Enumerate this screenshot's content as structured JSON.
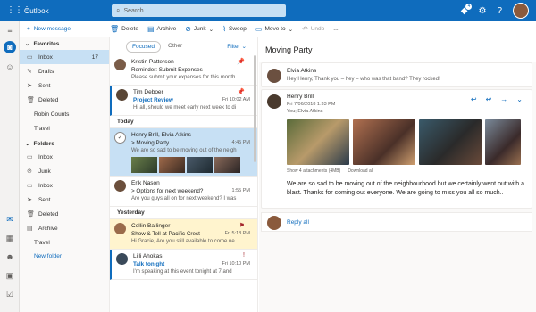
{
  "app": {
    "title": "Outlook"
  },
  "search": {
    "placeholder": "Search"
  },
  "topbar": {
    "notify_count": "4"
  },
  "command_bar": {
    "new_message": "New message",
    "delete": "Delete",
    "archive": "Archive",
    "junk": "Junk",
    "sweep": "Sweep",
    "move_to": "Move to",
    "undo": "Undo",
    "more": "..."
  },
  "sidebar": {
    "favorites_label": "Favorites",
    "favorites": [
      {
        "label": "Inbox",
        "count": "17"
      },
      {
        "label": "Drafts"
      },
      {
        "label": "Sent"
      },
      {
        "label": "Deleted"
      },
      {
        "label": "Robin Counts"
      },
      {
        "label": "Travel"
      }
    ],
    "folders_label": "Folders",
    "folders": [
      {
        "label": "Inbox"
      },
      {
        "label": "Junk"
      },
      {
        "label": "Inbox"
      },
      {
        "label": "Sent"
      },
      {
        "label": "Deleted"
      },
      {
        "label": "Archive"
      },
      {
        "label": "Travel"
      }
    ],
    "new_folder": "New folder"
  },
  "message_list": {
    "tabs": [
      "Focused",
      "Other"
    ],
    "filter": "Filter",
    "day_today": "Today",
    "day_yesterday": "Yesterday",
    "messages": [
      {
        "from": "Kristin Patterson",
        "subject": "Reminder: Submit Expenses",
        "time": "",
        "preview": "Please submit your expenses for this month"
      },
      {
        "from": "Tim Deboer",
        "subject": "Project Review",
        "time": "Fri 10:02 AM",
        "preview": "Hi all, should we meet early next week to di"
      },
      {
        "from": "Henry Brill, Elvia Atkins",
        "subject": "> Moving Party",
        "time": "4:45 PM",
        "preview": "We are so sad to be moving out of the neigh"
      },
      {
        "from": "Erik Nason",
        "subject": "> Options for next weekend?",
        "time": "1:55 PM",
        "preview": "Are you guys all on for next weekend? I was"
      },
      {
        "from": "Collin Ballinger",
        "subject": "Show & Tell at Pacific Crest",
        "time": "Fri 5:18 PM",
        "preview": "Hi Gracie, Are you still available to come ne"
      },
      {
        "from": "Lilli Ahokas",
        "subject": "Talk tonight",
        "time": "Fri 10:10 PM",
        "preview": "I'm speaking at this event tonight at 7 and"
      }
    ]
  },
  "reading": {
    "title": "Moving Party",
    "first": {
      "sender": "Elvia Atkins",
      "preview": "Hey Henry, Thank you – hey – who was that band? They rocked!"
    },
    "main": {
      "sender": "Henry Brill",
      "date": "Fri 7/06/2018 1:33 PM",
      "to": "You; Elvia Atkins",
      "attachments_info": "Show 4 attachments (4MB)",
      "download_all": "Download all",
      "body": "We are so sad to be moving out of the neighbourhood but we certainly went out with a blast. Thanks for coming out everyone. We are going to miss you all so much.."
    },
    "reply_all": "Reply all"
  },
  "colors": {
    "accent": "#0f6cbd",
    "selected": "#c7e0f4",
    "flagged": "#fff4ce"
  }
}
